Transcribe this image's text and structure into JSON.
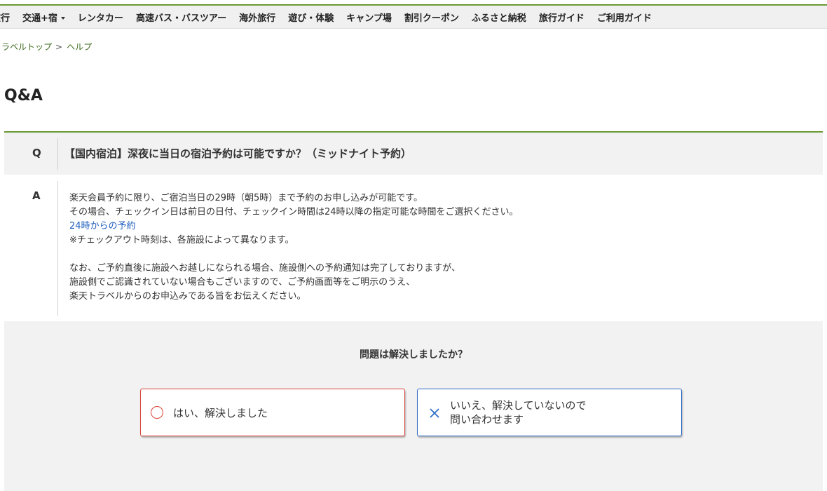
{
  "nav": {
    "items": [
      {
        "label": "旅行",
        "dropdown": false
      },
      {
        "label": "交通+宿",
        "dropdown": true
      },
      {
        "label": "レンタカー",
        "dropdown": false
      },
      {
        "label": "高速バス・バスツアー",
        "dropdown": false
      },
      {
        "label": "海外旅行",
        "dropdown": false
      },
      {
        "label": "遊び・体験",
        "dropdown": false
      },
      {
        "label": "キャンプ場",
        "dropdown": false
      },
      {
        "label": "割引クーポン",
        "dropdown": false
      },
      {
        "label": "ふるさと納税",
        "dropdown": false
      },
      {
        "label": "旅行ガイド",
        "dropdown": false
      },
      {
        "label": "ご利用ガイド",
        "dropdown": false
      }
    ]
  },
  "breadcrumb": {
    "home": "トラベルトップ",
    "separator": ">",
    "current": "ヘルプ"
  },
  "page": {
    "title": "Q&A"
  },
  "qa": {
    "q_mark": "Q",
    "question": "【国内宿泊】深夜に当日の宿泊予約は可能ですか？（ミッドナイト予約）",
    "a_mark": "A",
    "answer_lines_1": [
      "楽天会員予約に限り、ご宿泊当日の29時（朝5時）まで予約のお申し込みが可能です。",
      "その場合、チェックイン日は前日の日付、チェックイン時間は24時以降の指定可能な時間をご選択ください。"
    ],
    "answer_link": "24時からの予約",
    "answer_note": "※チェックアウト時刻は、各施設によって異なります。",
    "answer_lines_2": [
      "なお、ご予約直後に施設へお越しになられる場合、施設側への予約通知は完了しておりますが、",
      "施設側でご認識されていない場合もございますので、ご予約画面等をご明示のうえ、",
      "楽天トラベルからのお申込みである旨をお伝えください。"
    ]
  },
  "feedback": {
    "question": "問題は解決しましたか？",
    "yes_label": "はい、解決しました",
    "no_label_lines": [
      "いいえ、解決していないので",
      "問い合わせます"
    ],
    "yes_color": "#d9453a",
    "no_color": "#2e6cc6"
  },
  "theme": {
    "accent": "#6a9a35",
    "link": "#1f5fbf",
    "panel_bg": "#f2f2f2"
  }
}
